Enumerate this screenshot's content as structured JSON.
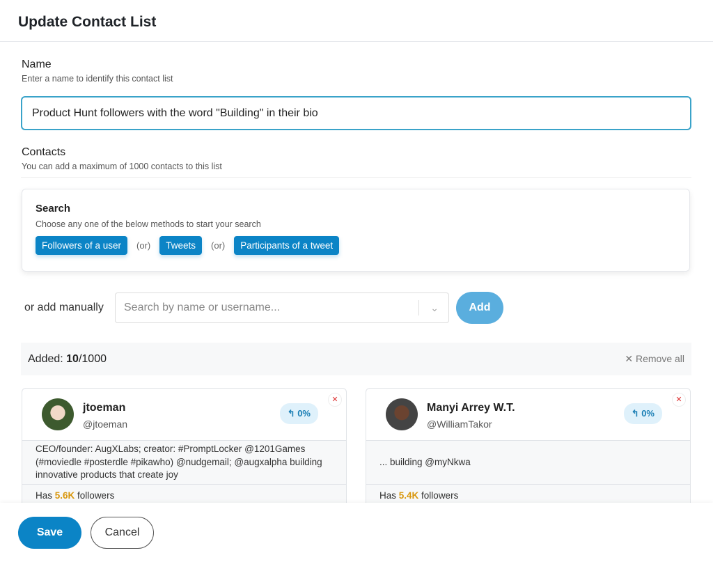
{
  "header": {
    "title": "Update Contact List"
  },
  "name": {
    "label": "Name",
    "hint": "Enter a name to identify this contact list",
    "value": "Product Hunt followers with the word \"Building\" in their bio"
  },
  "contacts": {
    "label": "Contacts",
    "hint": "You can add a maximum of 1000 contacts to this list"
  },
  "search": {
    "title": "Search",
    "hint": "Choose any one of the below methods to start your search",
    "methods": [
      "Followers of a user",
      "Tweets",
      "Participants of a tweet"
    ],
    "or": "(or)"
  },
  "manual": {
    "label": "or add manually",
    "placeholder": "Search by name or username...",
    "add": "Add"
  },
  "added": {
    "prefix": "Added: ",
    "count": "10",
    "max": "/1000",
    "remove_all": "Remove all"
  },
  "cards": [
    {
      "name": "jtoeman",
      "handle": "@jtoeman",
      "pct": "0%",
      "bio": "CEO/founder: AugXLabs; creator: #PromptLocker @1201Games (#moviedle #posterdle #pikawho) @nudgemail; @augxalpha building innovative products that create joy",
      "has": "Has ",
      "followers": "5.6K",
      "suffix": " followers"
    },
    {
      "name": "Manyi Arrey W.T.",
      "handle": "@WilliamTakor",
      "pct": "0%",
      "bio": "... building @myNkwa",
      "has": "Has ",
      "followers": "5.4K",
      "suffix": " followers"
    }
  ],
  "footer": {
    "save": "Save",
    "cancel": "Cancel"
  },
  "colors": {
    "primary": "#0b84c6",
    "accent": "#d9970e",
    "focus": "#3aa3c9"
  }
}
